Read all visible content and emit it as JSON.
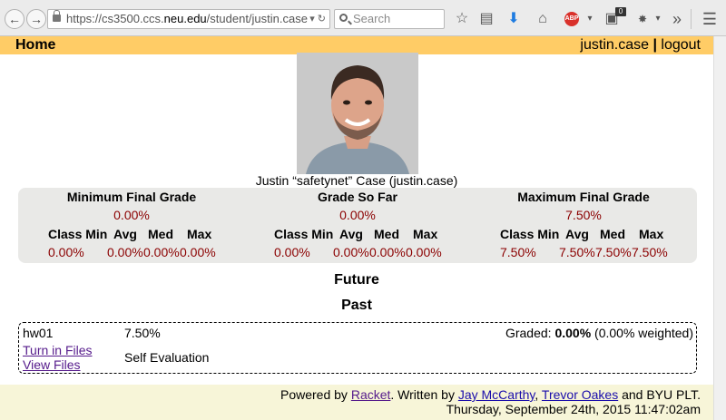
{
  "browser": {
    "url_prefix": "https://cs3500.ccs.",
    "url_host": "neu.edu",
    "url_path": "/student/justin.case",
    "search_placeholder": "Search",
    "notification_count": "0",
    "abp_label": "ABP"
  },
  "header": {
    "home": "Home",
    "username": "justin.case",
    "separator": "|",
    "logout": "logout"
  },
  "profile": {
    "caption": "Justin “safetynet” Case (justin.case)"
  },
  "grades": {
    "stat_headers": [
      "Class Min",
      "Avg",
      "Med",
      "Max"
    ],
    "columns": [
      {
        "title": "Minimum Final Grade",
        "value": "0.00%",
        "stats": [
          "0.00%",
          "0.00%",
          "0.00%",
          "0.00%"
        ]
      },
      {
        "title": "Grade So Far",
        "value": "0.00%",
        "stats": [
          "0.00%",
          "0.00%",
          "0.00%",
          "0.00%"
        ]
      },
      {
        "title": "Maximum Final Grade",
        "value": "7.50%",
        "stats": [
          "7.50%",
          "7.50%",
          "7.50%",
          "7.50%"
        ]
      }
    ]
  },
  "sections": {
    "future": "Future",
    "past": "Past"
  },
  "assignment": {
    "name": "hw01",
    "score": "7.50%",
    "graded_prefix": "Graded: ",
    "graded_value": "0.00%",
    "graded_weighted": " (0.00% weighted)",
    "turn_in": "Turn in Files",
    "view_files": "View Files",
    "self_eval": "Self Evaluation"
  },
  "footer": {
    "powered_by": "Powered by ",
    "racket": "Racket",
    "written_by": ". Written by ",
    "author1": "Jay McCarthy",
    "comma": ", ",
    "author2": "Trevor Oakes",
    "and_byu": " and BYU PLT.",
    "timestamp": "Thursday, September 24th, 2015 11:47:02am"
  }
}
